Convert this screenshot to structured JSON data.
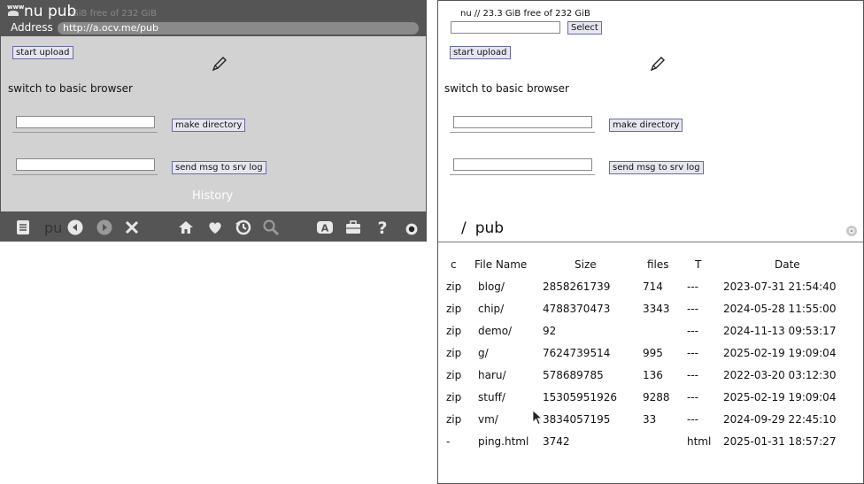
{
  "browser": {
    "title": "nu pub",
    "title_ghost": "GiB free of 232 GiB",
    "www_badge": "www",
    "address_label": "Address",
    "address_value": "http://a.ocv.me/pub",
    "history_label": "History",
    "toolbar_ghost": "pu"
  },
  "upload_form": {
    "start_upload": "start upload",
    "switch_browser": "switch to basic browser",
    "make_directory": "make directory",
    "send_msg": "send msg to srv log"
  },
  "page": {
    "site_name": "nu",
    "separator": "//",
    "free_space": "23.3 GiB free of 232 GiB",
    "select_button": "Select",
    "path_root": "/",
    "path_current": "pub"
  },
  "file_table": {
    "headers": {
      "c": "c",
      "name": "File Name",
      "size": "Size",
      "files": "files",
      "type": "T",
      "date": "Date"
    },
    "rows": [
      {
        "c": "zip",
        "name": "blog/",
        "size": "2858261739",
        "files": "714",
        "type": "---",
        "date": "2023-07-31 21:54:40"
      },
      {
        "c": "zip",
        "name": "chip/",
        "size": "4788370473",
        "files": "3343",
        "type": "---",
        "date": "2024-05-28 11:55:00"
      },
      {
        "c": "zip",
        "name": "demo/",
        "size": "92",
        "files": "",
        "type": "---",
        "date": "2024-11-13 09:53:17"
      },
      {
        "c": "zip",
        "name": "g/",
        "size": "7624739514",
        "files": "995",
        "type": "---",
        "date": "2025-02-19 19:09:04"
      },
      {
        "c": "zip",
        "name": "haru/",
        "size": "578689785",
        "files": "136",
        "type": "---",
        "date": "2022-03-20 03:12:30"
      },
      {
        "c": "zip",
        "name": "stuff/",
        "size": "15305951926",
        "files": "9288",
        "type": "---",
        "date": "2025-02-19 19:09:04"
      },
      {
        "c": "zip",
        "name": "vm/",
        "size": "3834057195",
        "files": "33",
        "type": "---",
        "date": "2024-09-29 22:45:10"
      },
      {
        "c": "-",
        "name": "ping.html",
        "size": "3742",
        "files": "",
        "type": "html",
        "date": "2025-01-31 18:57:27"
      }
    ]
  },
  "icons": [
    "www-icon",
    "pencil-icon",
    "bookmark-list-icon",
    "back-icon",
    "forward-icon",
    "stop-icon",
    "home-icon",
    "favorites-icon",
    "history-icon",
    "search-icon",
    "text-size-icon",
    "toolbox-icon",
    "help-icon",
    "settings-icon",
    "cursor-icon"
  ],
  "colors": {
    "chrome": "#555555",
    "top_background": "#d2d2d2",
    "button_border": "#6a6aa6",
    "button_fill": "#e6e6f0"
  }
}
